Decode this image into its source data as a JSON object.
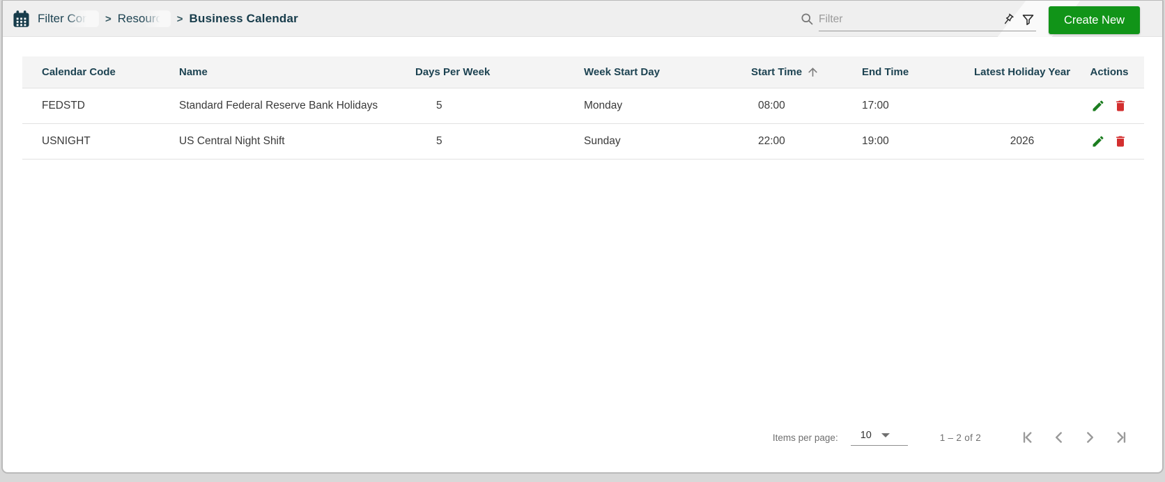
{
  "breadcrumb": {
    "separator": ">",
    "items": [
      {
        "label": "Filter Conf",
        "truncated": true
      },
      {
        "label": "Resource",
        "truncated": true
      }
    ],
    "current": "Business Calendar"
  },
  "topbar": {
    "filter_placeholder": "Filter",
    "filter_value": "",
    "create_button_label": "Create New"
  },
  "icons": {
    "app": "calendar-icon",
    "search": "search-icon",
    "pin": "push-pin-icon",
    "funnel": "filter-funnel-icon",
    "sort": "arrow-up-icon",
    "edit": "pencil-icon",
    "delete": "trash-icon",
    "first": "first-page-icon",
    "prev": "chevron-left-icon",
    "next": "chevron-right-icon",
    "last": "last-page-icon"
  },
  "table": {
    "columns": [
      "Calendar Code",
      "Name",
      "Days Per Week",
      "Week Start Day",
      "Start Time",
      "End Time",
      "Latest Holiday Year",
      "Actions"
    ],
    "sort": {
      "column": "Start Time",
      "direction": "asc"
    },
    "rows": [
      {
        "calendar_code": "FEDSTD",
        "name": "Standard Federal Reserve Bank Holidays",
        "days_per_week": "5",
        "week_start_day": "Monday",
        "start_time": "08:00",
        "end_time": "17:00",
        "latest_holiday_year": ""
      },
      {
        "calendar_code": "USNIGHT",
        "name": "US Central Night Shift",
        "days_per_week": "5",
        "week_start_day": "Sunday",
        "start_time": "22:00",
        "end_time": "19:00",
        "latest_holiday_year": "2026"
      }
    ]
  },
  "paginator": {
    "items_per_page_label": "Items per page:",
    "page_size": "10",
    "range_label": "1 – 2 of 2"
  },
  "colors": {
    "accent_green": "#119418",
    "edit_green": "#1b7d1f",
    "delete_red": "#d32f2f",
    "heading_teal": "#1d4352",
    "topbar_gray": "#efefef",
    "table_header_gray": "#f4f4f4"
  }
}
